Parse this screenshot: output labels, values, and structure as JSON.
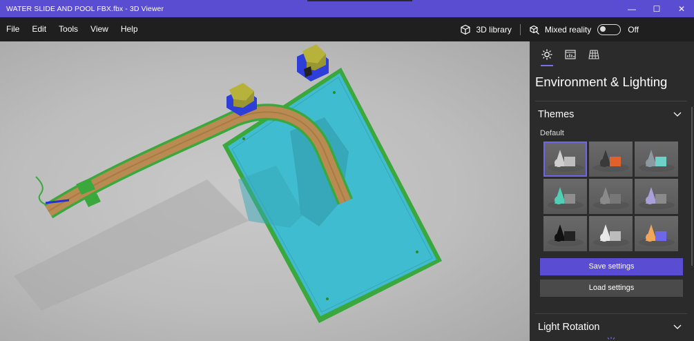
{
  "window": {
    "title": "WATER SLIDE AND POOL FBX.fbx - 3D Viewer",
    "controls": {
      "minimize": "—",
      "maximize": "☐",
      "close": "✕"
    }
  },
  "menu": {
    "items": [
      "File",
      "Edit",
      "Tools",
      "View",
      "Help"
    ],
    "library_label": "3D library",
    "mixed_reality_label": "Mixed reality",
    "mixed_reality_state": "Off"
  },
  "panel": {
    "tabs": [
      "sun-icon",
      "stats-icon",
      "grid-icon"
    ],
    "title": "Environment & Lighting",
    "themes": {
      "label": "Themes",
      "sub_label": "Default",
      "items": [
        {
          "name": "default",
          "shape_color": "#cfcfcf",
          "accent": "#bdbdbd"
        },
        {
          "name": "warm",
          "shape_color": "#3a3a3a",
          "accent": "#e0612a"
        },
        {
          "name": "teal-gray",
          "shape_color": "#8a9aa0",
          "accent": "#6fd0c8"
        },
        {
          "name": "teal",
          "shape_color": "#4fd0b5",
          "accent": "#8e8e8e"
        },
        {
          "name": "gray",
          "shape_color": "#8a8a8a",
          "accent": "#777777"
        },
        {
          "name": "violet",
          "shape_color": "#a9a0d9",
          "accent": "#8a8a8a"
        },
        {
          "name": "dark",
          "shape_color": "#111111",
          "accent": "#222222"
        },
        {
          "name": "light",
          "shape_color": "#e8e8e8",
          "accent": "#bcbcbc"
        },
        {
          "name": "sunset",
          "shape_color": "#f2a65a",
          "accent": "#6e67e8"
        }
      ]
    },
    "save_label": "Save settings",
    "load_label": "Load settings",
    "light_rotation_label": "Light Rotation"
  },
  "colors": {
    "accent": "#5b4dd1",
    "pool_water": "#40bcd0",
    "pool_border": "#3aa83c",
    "slide": "#b98a52"
  }
}
